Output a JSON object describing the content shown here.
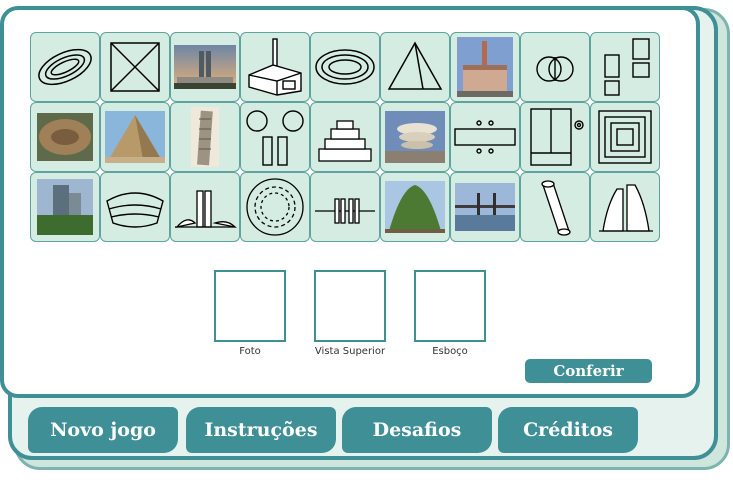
{
  "colors": {
    "accent": "#3f8f96",
    "tile_bg": "#d4ece1",
    "frame_bg": "#e6f2ed"
  },
  "tiles": [
    {
      "kind": "drawing",
      "icon": "oval-ring-perspective-icon"
    },
    {
      "kind": "drawing",
      "icon": "square-with-diagonals-icon"
    },
    {
      "kind": "photo",
      "icon": "congress-building-photo"
    },
    {
      "kind": "drawing",
      "icon": "factory-with-chimney-icon"
    },
    {
      "kind": "drawing",
      "icon": "stadium-top-view-icon"
    },
    {
      "kind": "drawing",
      "icon": "pyramid-icon"
    },
    {
      "kind": "photo",
      "icon": "factory-chimney-photo"
    },
    {
      "kind": "drawing",
      "icon": "overlapping-circles-icon"
    },
    {
      "kind": "drawing",
      "icon": "offset-rectangles-icon"
    },
    {
      "kind": "photo",
      "icon": "colosseum-photo"
    },
    {
      "kind": "photo",
      "icon": "pyramid-photo"
    },
    {
      "kind": "photo",
      "icon": "leaning-tower-photo"
    },
    {
      "kind": "drawing",
      "icon": "circles-and-bars-icon"
    },
    {
      "kind": "drawing",
      "icon": "stepped-ziggurat-icon"
    },
    {
      "kind": "photo",
      "icon": "guggenheim-photo"
    },
    {
      "kind": "drawing",
      "icon": "bridge-top-view-icon"
    },
    {
      "kind": "drawing",
      "icon": "split-building-plan-icon"
    },
    {
      "kind": "drawing",
      "icon": "concentric-squares-icon"
    },
    {
      "kind": "photo",
      "icon": "towers-trees-photo"
    },
    {
      "kind": "drawing",
      "icon": "curved-building-icon"
    },
    {
      "kind": "drawing",
      "icon": "twin-towers-bowls-icon"
    },
    {
      "kind": "drawing",
      "icon": "stadium-seats-circle-icon"
    },
    {
      "kind": "drawing",
      "icon": "bridge-pillars-icon"
    },
    {
      "kind": "photo",
      "icon": "green-building-photo"
    },
    {
      "kind": "photo",
      "icon": "bridge-photo"
    },
    {
      "kind": "drawing",
      "icon": "leaning-cylinder-icon"
    },
    {
      "kind": "drawing",
      "icon": "curved-towers-icon"
    }
  ],
  "slots": {
    "photo_label": "Foto",
    "top_view_label": "Vista Superior",
    "sketch_label": "Esboço"
  },
  "check_button": "Conferir",
  "tabs": [
    "Novo jogo",
    "Instruções",
    "Desafios",
    "Créditos"
  ]
}
